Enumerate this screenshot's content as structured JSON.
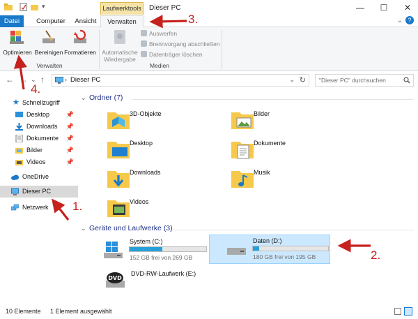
{
  "window": {
    "context_tab_label": "Laufwerktools",
    "title": "Dieser PC",
    "controls": [
      "minimize",
      "maximize",
      "close"
    ]
  },
  "ribbon_tabs": [
    {
      "label": "Datei"
    },
    {
      "label": "Computer"
    },
    {
      "label": "Ansicht"
    },
    {
      "label": "Verwalten"
    }
  ],
  "ribbon": {
    "optimieren": "Optimieren",
    "bereinigen": "Bereinigen",
    "formatieren": "Formatieren",
    "group_verwalten": "Verwalten",
    "autoplay_line1": "Automatische",
    "autoplay_line2": "Wiedergabe",
    "auswerfen": "Auswerfen",
    "brennvorgang": "Brennvorgang abschließen",
    "datentraeger_loeschen": "Datenträger löschen",
    "group_medien": "Medien"
  },
  "address": {
    "path": "Dieser PC",
    "search_placeholder": "\"Dieser PC\" durchsuchen"
  },
  "nav_pane": {
    "items": [
      {
        "label": "Schnellzugriff"
      },
      {
        "label": "Desktop"
      },
      {
        "label": "Downloads"
      },
      {
        "label": "Dokumente"
      },
      {
        "label": "Bilder"
      },
      {
        "label": "Videos"
      },
      {
        "label": "OneDrive"
      },
      {
        "label": "Dieser PC"
      },
      {
        "label": "Netzwerk"
      }
    ]
  },
  "content": {
    "folders_header": "Ordner (7)",
    "folders": [
      {
        "label": "3D-Objekte"
      },
      {
        "label": "Bilder"
      },
      {
        "label": "Desktop"
      },
      {
        "label": "Dokumente"
      },
      {
        "label": "Downloads"
      },
      {
        "label": "Musik"
      },
      {
        "label": "Videos"
      }
    ],
    "drives_header": "Geräte und Laufwerke (3)",
    "drives": [
      {
        "name": "System (C:)",
        "free": "152 GB frei von 269 GB",
        "used_fraction": 0.43
      },
      {
        "name": "Daten (D:)",
        "free": "180 GB frei von 195 GB",
        "used_fraction": 0.08
      },
      {
        "name": "DVD-RW-Laufwerk (E:)"
      }
    ]
  },
  "status": {
    "count": "10 Elemente",
    "selected": "1 Element ausgewählt"
  },
  "annotations": {
    "n1": "1.",
    "n2": "2.",
    "n3": "3.",
    "n4": "4."
  },
  "colors": {
    "accent": "#1979ca",
    "selection": "#cce8ff",
    "context_tab": "#f5e3a8",
    "annotation_red": "#c5221f",
    "folder_yellow": "#f6c94a"
  }
}
